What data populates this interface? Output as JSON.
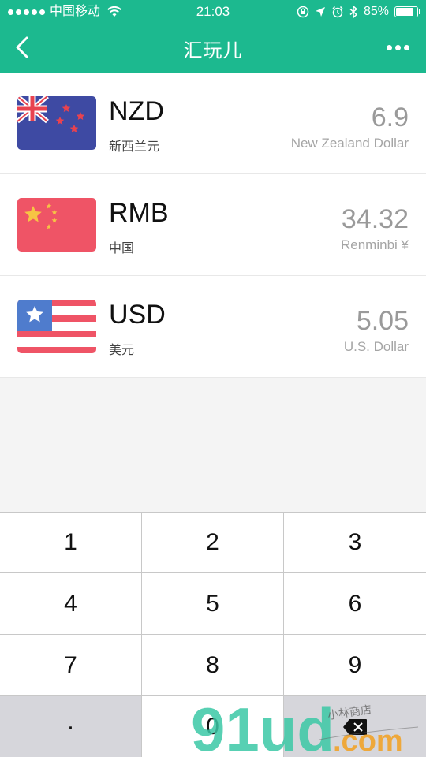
{
  "status_bar": {
    "carrier": "中国移动",
    "time": "21:03",
    "battery": "85%",
    "battery_level": 0.85
  },
  "nav": {
    "title": "汇玩儿"
  },
  "currencies": [
    {
      "code": "NZD",
      "local_name": "新西兰元",
      "amount": "6.9",
      "english_name": "New Zealand Dollar"
    },
    {
      "code": "RMB",
      "local_name": "中国",
      "amount": "34.32",
      "english_name": "Renminbi ¥"
    },
    {
      "code": "USD",
      "local_name": "美元",
      "amount": "5.05",
      "english_name": "U.S. Dollar"
    }
  ],
  "keypad": {
    "keys": [
      "1",
      "2",
      "3",
      "4",
      "5",
      "6",
      "7",
      "8",
      "9",
      "·",
      "0",
      "⌫"
    ]
  },
  "watermark": {
    "logo": "91ud.com",
    "tagline": "小林商店"
  },
  "colors": {
    "accent": "#1cb98f"
  }
}
